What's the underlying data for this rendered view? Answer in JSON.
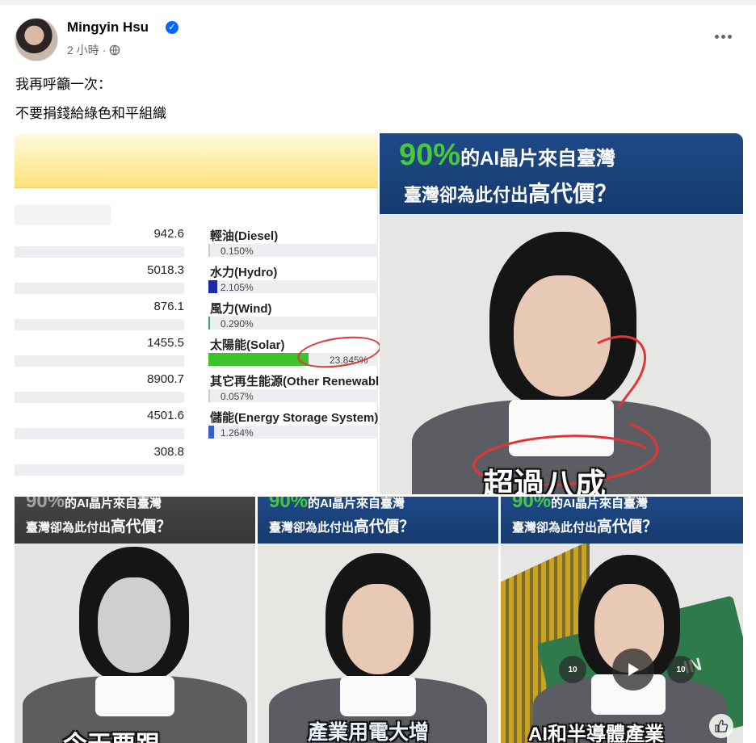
{
  "post": {
    "author": "Mingyin Hsu",
    "verified_mark": "✓",
    "time": "2 小時",
    "separator": "·",
    "privacy_icon": "globe-icon",
    "more_icon": "more-horizontal-icon",
    "text_lines": [
      "我再呼籲一次：",
      "不要捐錢給綠色和平組織"
    ]
  },
  "chart_data": {
    "type": "table",
    "rows": [
      {
        "value": "942.6",
        "label": "輕油(Diesel)",
        "percent": "0.150%",
        "share": 0.15,
        "color": "#cccccc"
      },
      {
        "value": "5018.3",
        "label": "水力(Hydro)",
        "percent": "2.105%",
        "share": 2.105,
        "color": "#1a2aa8"
      },
      {
        "value": "876.1",
        "label": "風力(Wind)",
        "percent": "0.290%",
        "share": 0.29,
        "color": "#2fa66a"
      },
      {
        "value": "1455.5",
        "label": "太陽能(Solar)",
        "percent": "23.845%",
        "share": 23.845,
        "color": "#3cc22a"
      },
      {
        "value": "8900.7",
        "label": "其它再生能源(Other Renewabl",
        "percent": "0.057%",
        "share": 0.057,
        "color": "#cccccc"
      },
      {
        "value": "4501.6",
        "label": "儲能(Energy Storage System)",
        "percent": "1.264%",
        "share": 1.264,
        "color": "#3a5fc4"
      },
      {
        "value": "308.8",
        "label": "",
        "percent": "",
        "share": 0,
        "color": "#cccccc"
      }
    ]
  },
  "video": {
    "banner_pct": "90%",
    "banner_line1": "的AI晶片來自臺灣",
    "banner_line2_a": "臺灣卻為此付出",
    "banner_line2_b": "高代價？",
    "captions": {
      "main": "超過八成",
      "tile1": "今天要跟",
      "tile2": "產業用電大增",
      "tile3": "AI和半導體產業"
    },
    "chip_label": "IN",
    "rewind_label": "10",
    "forward_label": "10",
    "colors": {
      "banner": "#1f4a88",
      "accent_green": "#47c93a",
      "annotation_red": "#e43535"
    }
  }
}
